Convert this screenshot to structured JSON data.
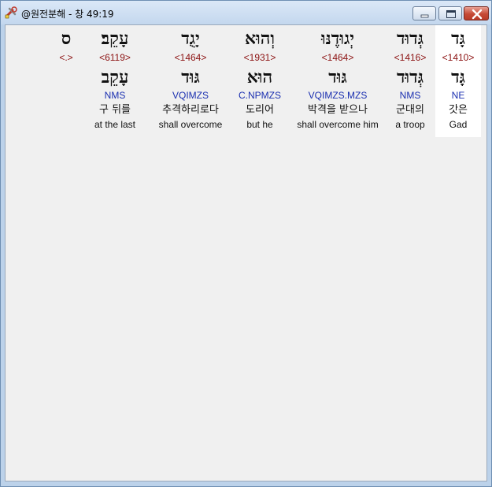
{
  "window": {
    "title": "@원전분해 - 창 49:19",
    "icon": "tools-icon"
  },
  "words": [
    {
      "hebrew": "גָּד",
      "strongs": "<1410>",
      "lemma": "גָּד",
      "parse": "NE",
      "korean": "갓은",
      "english": "Gad",
      "selected": true
    },
    {
      "hebrew": "גְּדוּד",
      "strongs": "<1416>",
      "lemma": "גְּדוּד",
      "parse": "NMS",
      "korean": "군대의",
      "english": "a troop"
    },
    {
      "hebrew": "יְגוּדֶנּוּ",
      "strongs": "<1464>",
      "lemma": "גּוּד",
      "parse": "VQIMZS.MZS",
      "korean": "박격을 받으나",
      "english": "shall overcome him"
    },
    {
      "hebrew": "וְהוּא",
      "strongs": "<1931>",
      "lemma": "הוּא",
      "parse": "C.NPMZS",
      "korean": "도리어",
      "english": "but he"
    },
    {
      "hebrew": "יָגֻד",
      "strongs": "<1464>",
      "lemma": "גּוּד",
      "parse": "VQIMZS",
      "korean": "추격하리로다",
      "english": "shall overcome"
    },
    {
      "hebrew": "עָקֵב׃",
      "strongs": "<6119>",
      "lemma": "עָקֵב",
      "parse": "NMS",
      "korean": "구 뒤를",
      "english": "at the last"
    },
    {
      "hebrew": "ס",
      "strongs": "<.>",
      "lemma": "",
      "parse": "",
      "korean": "",
      "english": ""
    }
  ]
}
